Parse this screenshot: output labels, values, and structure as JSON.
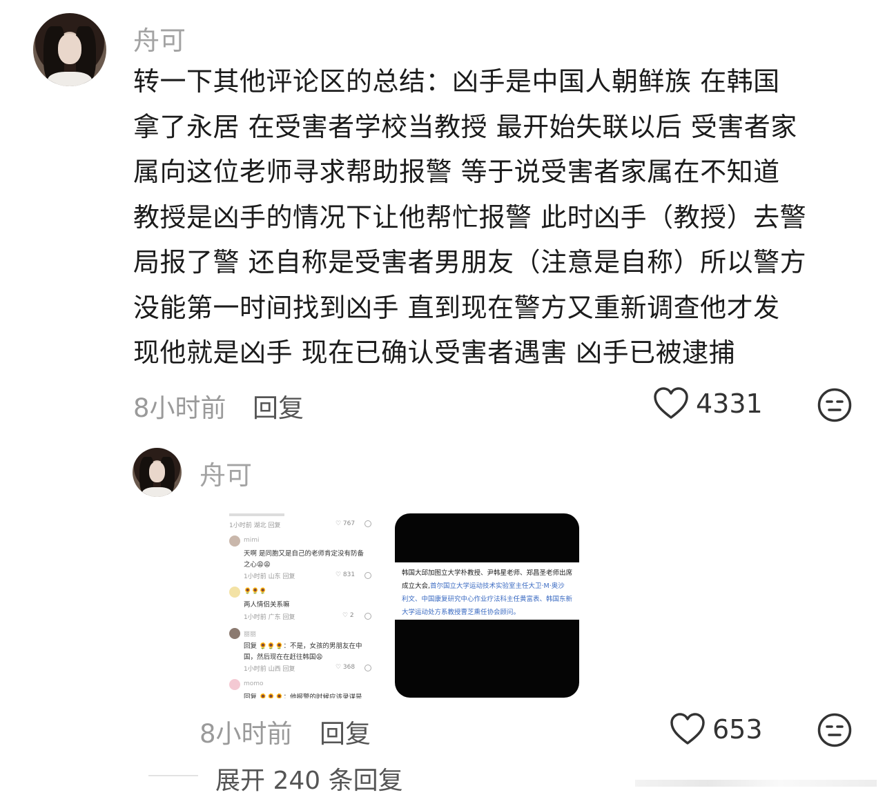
{
  "comment1": {
    "username": "舟可",
    "lines": [
      "转一下其他评论区的总结：凶手是中国人朝鲜族 在韩国",
      "拿了永居 在受害者学校当教授 最开始失联以后 受害者家",
      "属向这位老师寻求帮助报警 等于说受害者家属在不知道",
      "教授是凶手的情况下让他帮忙报警  此时凶手（教授）去警",
      "局报了警 还自称是受害者男朋友（注意是自称）所以警方",
      "没能第一时间找到凶手 直到现在警方又重新调查他才发",
      "现他就是凶手 现在已确认受害者遇害 凶手已被逮捕"
    ],
    "time": "8小时前",
    "reply": "回复",
    "likes": "4331",
    "like_icon": "heart-outline-icon",
    "react_icon": "neutral-face-icon"
  },
  "comment2": {
    "username": "舟可",
    "time": "8小时前",
    "reply": "回复",
    "likes": "653",
    "like_icon": "heart-outline-icon",
    "react_icon": "neutral-face-icon",
    "image1": {
      "top_meta": "1小时前 湖北  回复",
      "top_likes": "♡ 767",
      "items": [
        {
          "name": "mimi",
          "text1": "天啊 是同胞又是自己的老师肯定没有防备",
          "text2": "之心😩😩",
          "meta": "1小时前 山东  回复",
          "likes": "♡ 831"
        },
        {
          "name": "🌻🌻🌻",
          "text1": "两人情侣关系嘛",
          "text2": "",
          "meta": "1小时前 广东  回复",
          "likes": "♡ 2"
        },
        {
          "name": "丽丽",
          "text1": "回复 🌻🌻🌻：不是，女孩的男朋友在中",
          "text2": "国，然后现在在赶往韩国😩",
          "meta": "1小时前 山西  回复",
          "likes": "♡ 368"
        },
        {
          "name": "momo",
          "text1": "回复 🌻🌻🌻：他报警的时候应该录谋是",
          "text2": "",
          "meta": "",
          "likes": ""
        }
      ]
    },
    "image2": {
      "line1": "韩国大邱加图立大学朴教授、尹韩星老师、郑昌圣老师出席",
      "line2": "成立大会,",
      "line2_blue": "首尔国立大学运动技术实验室主任大卫·M·奥沙",
      "line3": "利文、中国康复研究中心作业疗法科主任黄富表、韩国东新",
      "line4": "大学运动处方系教授曹芝熏任协会顾问。"
    }
  },
  "expand": {
    "label": "展开 240 条回复"
  }
}
